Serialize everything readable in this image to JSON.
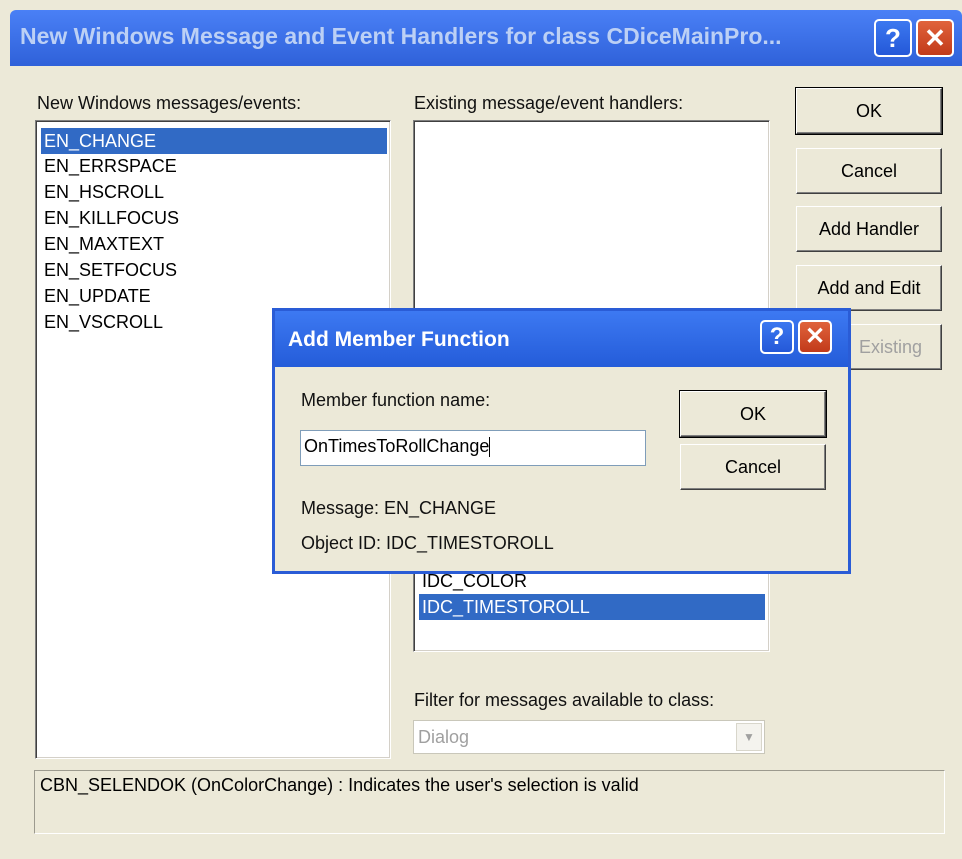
{
  "window": {
    "title": "New Windows Message and Event Handlers for class CDiceMainPro...",
    "help_glyph": "?",
    "close_glyph": "✕"
  },
  "left_panel": {
    "label": "New Windows messages/events:",
    "items": [
      {
        "label": "EN_CHANGE",
        "selected": true
      },
      {
        "label": "EN_ERRSPACE",
        "selected": false
      },
      {
        "label": "EN_HSCROLL",
        "selected": false
      },
      {
        "label": "EN_KILLFOCUS",
        "selected": false
      },
      {
        "label": "EN_MAXTEXT",
        "selected": false
      },
      {
        "label": "EN_SETFOCUS",
        "selected": false
      },
      {
        "label": "EN_UPDATE",
        "selected": false
      },
      {
        "label": "EN_VSCROLL",
        "selected": false
      }
    ]
  },
  "middle_panel": {
    "label": "Existing message/event handlers:",
    "items": [
      {
        "label": "IDC_COLOR",
        "selected": false
      },
      {
        "label": "IDC_TIMESTOROLL",
        "selected": true
      }
    ],
    "filter_label": "Filter for messages available to class:",
    "filter_value": "Dialog",
    "filter_arrow": "▼"
  },
  "buttons": {
    "ok": "OK",
    "cancel": "Cancel",
    "add_handler": "Add Handler",
    "add_and_edit": "Add and Edit",
    "edit_existing": "Existing"
  },
  "status_text": "CBN_SELENDOK (OnColorChange) : Indicates the user's selection is valid",
  "modal": {
    "title": "Add Member Function",
    "help_glyph": "?",
    "close_glyph": "✕",
    "name_label": "Member function name:",
    "name_value": "OnTimesToRollChange",
    "ok": "OK",
    "cancel": "Cancel",
    "message_line": "Message: EN_CHANGE",
    "object_line": "Object ID: IDC_TIMESTOROLL"
  },
  "colors": {
    "titlebar": "#2f61d9",
    "selection": "#316ac5",
    "dialog_bg": "#ece9d8"
  }
}
